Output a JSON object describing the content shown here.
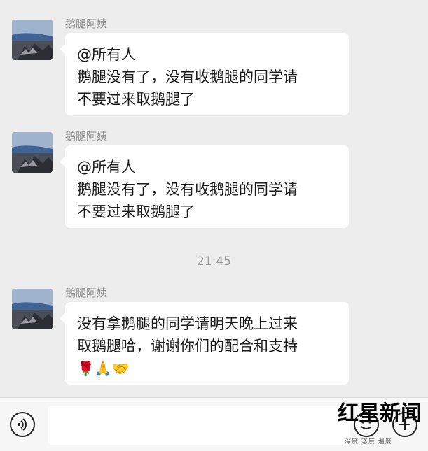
{
  "chat": {
    "messages": [
      {
        "sender": "鹅腿阿姨",
        "lines": [
          "@所有人",
          "鹅腿没有了，没有收鹅腿的同学请",
          "不要过来取鹅腿了"
        ]
      },
      {
        "sender": "鹅腿阿姨",
        "lines": [
          "@所有人",
          "鹅腿没有了，没有收鹅腿的同学请",
          "不要过来取鹅腿了"
        ]
      },
      {
        "sender": "鹅腿阿姨",
        "lines": [
          "没有拿鹅腿的同学请明天晚上过来",
          "取鹅腿哈，谢谢你们的配合和支持"
        ],
        "emojis": "🌹🙏🤝"
      }
    ],
    "timestamp": "21:45"
  },
  "input_bar": {
    "voice_icon": "voice-icon",
    "emoji_icon": "emoji-icon",
    "plus_icon": "plus-icon"
  },
  "watermark": {
    "brand": "红星新闻",
    "tagline": "深度 态度 温度"
  },
  "colors": {
    "background": "#ededed",
    "bubble": "#ffffff",
    "sender_text": "#8a8a8a",
    "watermark_red": "#d9262b"
  }
}
